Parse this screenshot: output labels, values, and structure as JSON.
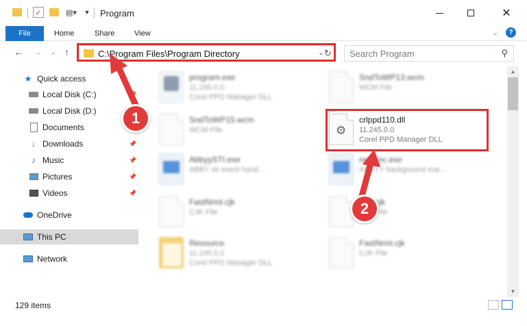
{
  "window": {
    "title": "Program",
    "minimize_icon": "minimize-icon",
    "maximize_icon": "maximize-icon",
    "close_icon": "close-icon"
  },
  "ribbon": {
    "tabs": [
      "File",
      "Home",
      "Share",
      "View"
    ],
    "help_label": "?"
  },
  "address": {
    "path": "C:\\Program Files\\Program Directory",
    "search_placeholder": "Search Program"
  },
  "sidebar": {
    "items": [
      {
        "label": "Quick access",
        "icon": "star-icon"
      },
      {
        "label": "Local Disk (C:)",
        "icon": "drive-icon"
      },
      {
        "label": "Local Disk (D:)",
        "icon": "drive-icon"
      },
      {
        "label": "Documents",
        "icon": "documents-icon"
      },
      {
        "label": "Downloads",
        "icon": "download-icon"
      },
      {
        "label": "Music",
        "icon": "music-icon"
      },
      {
        "label": "Pictures",
        "icon": "pictures-icon"
      },
      {
        "label": "Videos",
        "icon": "videos-icon"
      },
      {
        "label": "OneDrive",
        "icon": "cloud-icon"
      },
      {
        "label": "This PC",
        "icon": "computer-icon"
      },
      {
        "label": "Network",
        "icon": "network-icon"
      }
    ]
  },
  "files": [
    {
      "name": "program.exe",
      "line1": "11.245.0.0",
      "line2": "Corel PPD Manager DLL"
    },
    {
      "name": "SndToWP13.wcm",
      "line1": "WCM File",
      "line2": ""
    },
    {
      "name": "SndToWP15.wcm",
      "line1": "WCM File",
      "line2": ""
    },
    {
      "name": "crlppd110.dll",
      "line1": "11.245.0.0",
      "line2": "Corel PPD Manager DLL"
    },
    {
      "name": "AbbyySTI.exe",
      "line1": "ABBY sti event hand...",
      "line2": ""
    },
    {
      "name": "neExec.exe",
      "line1": "ABBYY background exe...",
      "line2": ""
    },
    {
      "name": "FastNrml.cjk",
      "line1": "CJK File",
      "line2": ""
    },
    {
      "name": "ean.cjk",
      "line1": "CJK File",
      "line2": ""
    },
    {
      "name": "Resource",
      "line1": "11.245.0.0",
      "line2": "Corel PPD Manager DLL"
    },
    {
      "name": "FastNrml.cjk",
      "line1": "CJK File",
      "line2": ""
    }
  ],
  "status": {
    "item_count": "129 items"
  },
  "callouts": [
    "1",
    "2"
  ],
  "colors": {
    "accent": "#1a73c9",
    "highlight": "#e02e2e",
    "callout": "#e03a3a"
  }
}
